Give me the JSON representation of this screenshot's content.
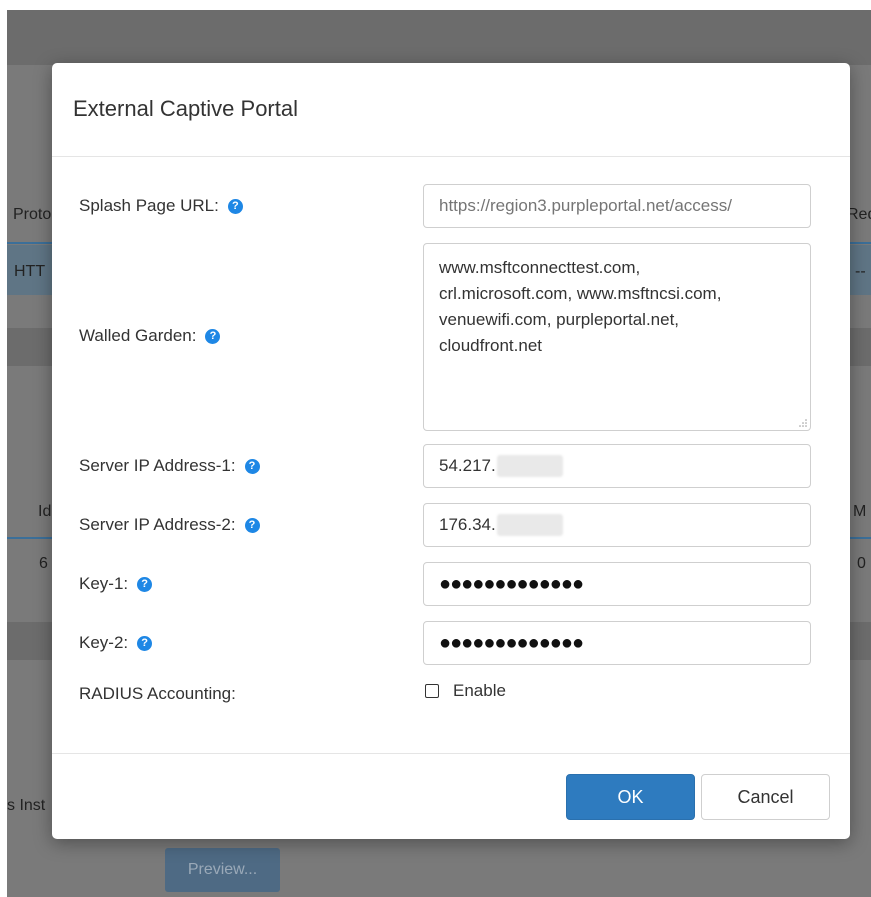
{
  "background": {
    "col_protocol": "Proto",
    "col_red": "Red",
    "row_protocol": "HTT",
    "row_dash": "--",
    "col_id": "Id",
    "col_m": "M",
    "row_id": "6",
    "row_m": "0",
    "side_text": "s Inst",
    "preview_label": "Preview..."
  },
  "modal": {
    "title": "External Captive Portal",
    "fields": {
      "splash_label": "Splash Page URL:",
      "splash_placeholder": "https://region3.purpleportal.net/access/",
      "walled_label": "Walled Garden:",
      "walled_lines": [
        "www.msftconnecttest.com,",
        "crl.microsoft.com, www.msftncsi.com,",
        "venuewifi.com, purpleportal.net,",
        "cloudfront.net"
      ],
      "ip1_label": "Server IP Address-1:",
      "ip1_value": "54.217.",
      "ip2_label": "Server IP Address-2:",
      "ip2_value": "176.34.",
      "key1_label": "Key-1:",
      "key1_value": "●●●●●●●●●●●●●",
      "key2_label": "Key-2:",
      "key2_value": "●●●●●●●●●●●●●",
      "radius_label": "RADIUS Accounting:",
      "enable_label": "Enable",
      "enable_checked": false
    },
    "help_glyph": "?",
    "buttons": {
      "ok": "OK",
      "cancel": "Cancel"
    }
  },
  "colors": {
    "primary": "#2e7bbf",
    "help_icon": "#1e87e5"
  }
}
